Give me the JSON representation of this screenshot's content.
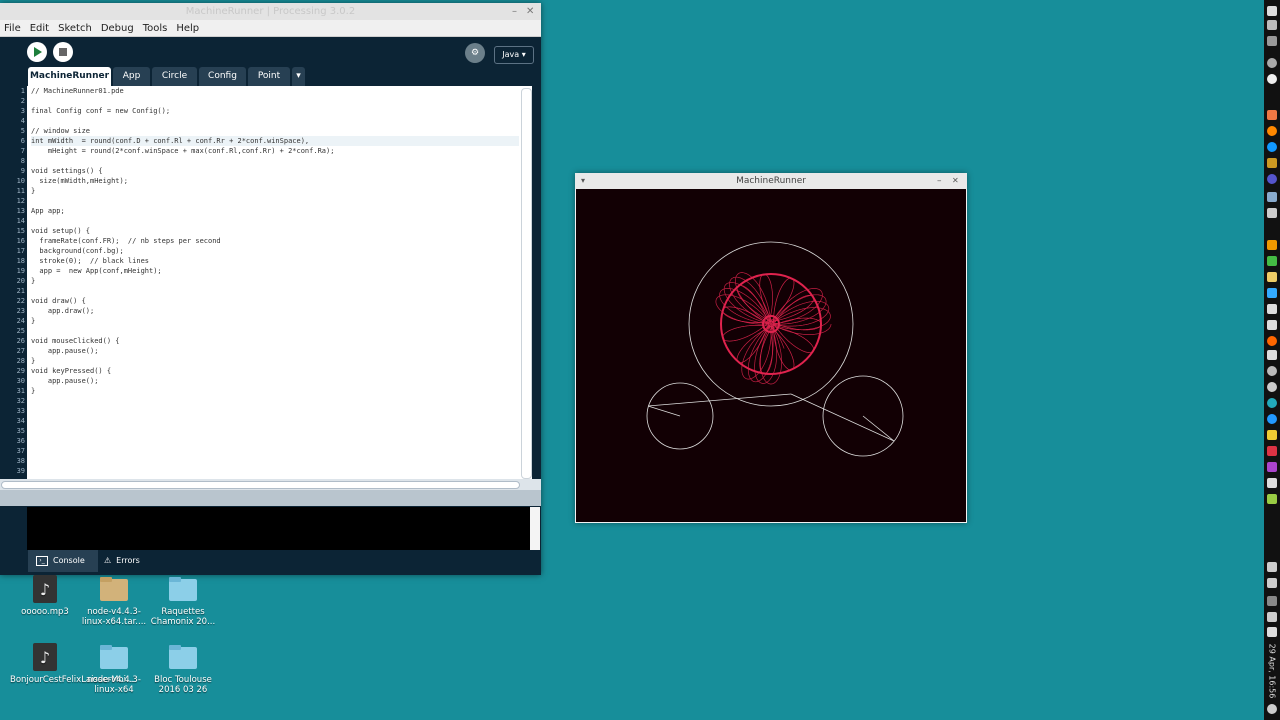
{
  "ide": {
    "title": "MachineRunner | Processing 3.0.2",
    "menu": [
      "File",
      "Edit",
      "Sketch",
      "Debug",
      "Tools",
      "Help"
    ],
    "mode": "Java ▾",
    "tabs": [
      "MachineRunner",
      "App",
      "Circle",
      "Config",
      "Point"
    ],
    "tab_more": "▾",
    "line_numbers": [
      "1",
      "2",
      "3",
      "4",
      "5",
      "6",
      "7",
      "8",
      "9",
      "10",
      "11",
      "12",
      "13",
      "14",
      "15",
      "16",
      "17",
      "18",
      "19",
      "20",
      "21",
      "22",
      "23",
      "24",
      "25",
      "26",
      "27",
      "28",
      "29",
      "30",
      "31",
      "32",
      "33",
      "34",
      "35",
      "36",
      "37",
      "38",
      "39"
    ],
    "code": [
      "// MachineRunner01.pde",
      "",
      "final Config conf = new Config();",
      "",
      "// window size",
      "int mWidth  = round(conf.D + conf.Rl + conf.Rr + 2*conf.winSpace),",
      "    mHeight = round(2*conf.winSpace + max(conf.Rl,conf.Rr) + 2*conf.Ra);",
      "",
      "void settings() {",
      "  size(mWidth,mHeight);",
      "}",
      "",
      "App app;",
      "",
      "void setup() {",
      "  frameRate(conf.FR);  // nb steps per second",
      "  background(conf.bg);",
      "  stroke(0);  // black lines",
      "  app =  new App(conf,mHeight);",
      "}",
      "",
      "void draw() {",
      "    app.draw();",
      "}",
      "",
      "void mouseClicked() {",
      "    app.pause();",
      "}",
      "void keyPressed() {",
      "    app.pause();",
      "}",
      "",
      "",
      "",
      "",
      "",
      "",
      "",
      ""
    ],
    "console_tabs": [
      "Console",
      "Errors"
    ]
  },
  "sketch": {
    "title": "MachineRunner"
  },
  "desktop": [
    {
      "label": "ooooo.mp3",
      "type": "audio"
    },
    {
      "label": "node-v4.4.3-linux-x64.tar....",
      "type": "archive"
    },
    {
      "label": "Raquettes Chamonix 20...",
      "type": "folder"
    },
    {
      "label": "BonjourCestFelixLaisserMoi...",
      "type": "audio"
    },
    {
      "label": "node-v4.4.3-linux-x64",
      "type": "folder"
    },
    {
      "label": "Bloc Toulouse 2016 03 26",
      "type": "folder"
    }
  ],
  "panel": {
    "clock": "29 Apr, 16:56"
  },
  "colors": {
    "accent": "#e0234e",
    "ide_bg": "#0c2435",
    "desktop": "#178e9a"
  }
}
